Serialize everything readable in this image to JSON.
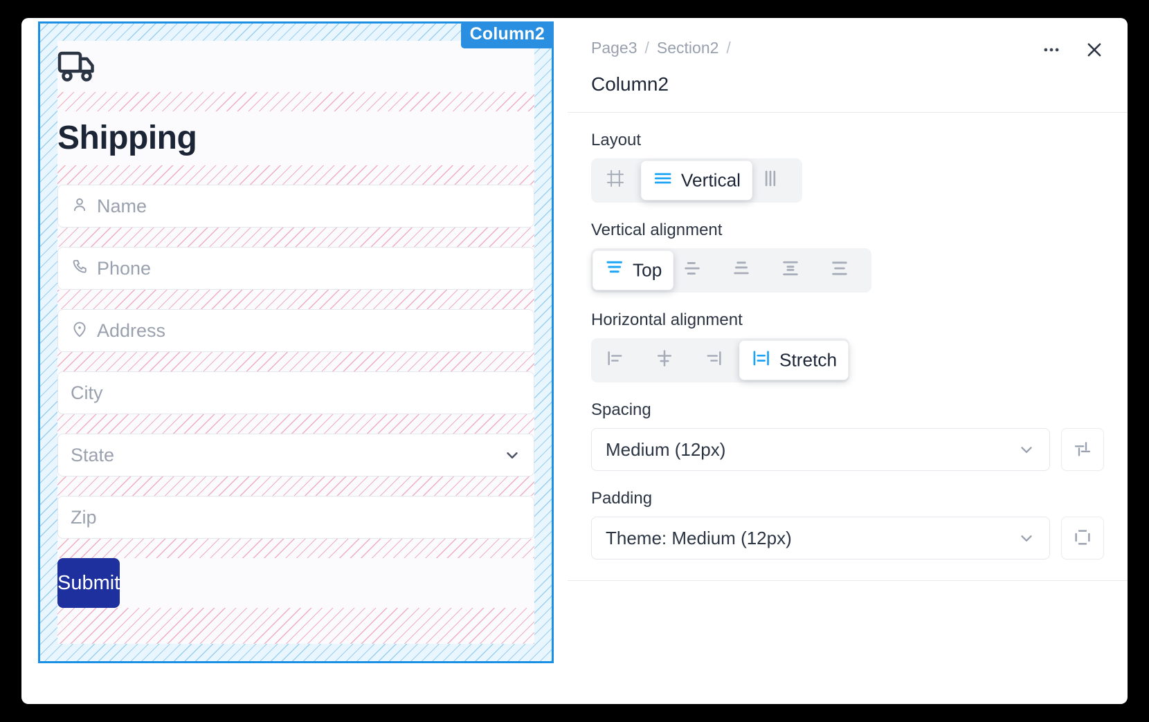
{
  "canvas": {
    "selection_badge": "Column2",
    "selection_color": "#2a8fe0",
    "padding_hatch_color": "#5aafe6",
    "spacing_hatch_color": "#e86c8c",
    "form": {
      "icon": "truck-icon",
      "title": "Shipping",
      "fields": [
        {
          "placeholder": "Name",
          "icon": "person-icon",
          "type": "text"
        },
        {
          "placeholder": "Phone",
          "icon": "phone-icon",
          "type": "text"
        },
        {
          "placeholder": "Address",
          "icon": "map-pin-icon",
          "type": "text"
        },
        {
          "placeholder": "City",
          "icon": "",
          "type": "text"
        },
        {
          "placeholder": "State",
          "icon": "",
          "type": "select"
        },
        {
          "placeholder": "Zip",
          "icon": "",
          "type": "text"
        }
      ],
      "submit_label": "Submit",
      "submit_color": "#1e2f9e"
    }
  },
  "panel": {
    "breadcrumb": [
      "Page3",
      "Section2"
    ],
    "breadcrumb_separator": "/",
    "title": "Column2",
    "more_label": "•••",
    "close_label": "✕",
    "sections": {
      "layout": {
        "label": "Layout",
        "options": [
          {
            "id": "free",
            "label": "",
            "icon": "frame-icon",
            "selected": false
          },
          {
            "id": "vertical",
            "label": "Vertical",
            "icon": "rows-icon",
            "selected": true
          },
          {
            "id": "horizontal",
            "label": "",
            "icon": "columns-icon",
            "selected": false
          }
        ]
      },
      "vertical_alignment": {
        "label": "Vertical alignment",
        "options": [
          {
            "id": "top",
            "label": "Top",
            "icon": "align-top-icon",
            "selected": true
          },
          {
            "id": "middle",
            "label": "",
            "icon": "align-middle-icon",
            "selected": false
          },
          {
            "id": "bottom",
            "label": "",
            "icon": "align-bottom-icon",
            "selected": false
          },
          {
            "id": "space-between",
            "label": "",
            "icon": "align-space-between-icon",
            "selected": false
          },
          {
            "id": "stretch",
            "label": "",
            "icon": "align-stretch-v-icon",
            "selected": false
          }
        ]
      },
      "horizontal_alignment": {
        "label": "Horizontal alignment",
        "options": [
          {
            "id": "left",
            "label": "",
            "icon": "align-left-icon",
            "selected": false
          },
          {
            "id": "center",
            "label": "",
            "icon": "align-center-icon",
            "selected": false
          },
          {
            "id": "right",
            "label": "",
            "icon": "align-right-icon",
            "selected": false
          },
          {
            "id": "stretch",
            "label": "Stretch",
            "icon": "align-stretch-h-icon",
            "selected": true
          }
        ]
      },
      "spacing": {
        "label": "Spacing",
        "value": "Medium (12px)",
        "detail_icon": "sliders-icon"
      },
      "padding": {
        "label": "Padding",
        "value": "Theme: Medium (12px)",
        "detail_icon": "padding-box-icon"
      }
    }
  }
}
